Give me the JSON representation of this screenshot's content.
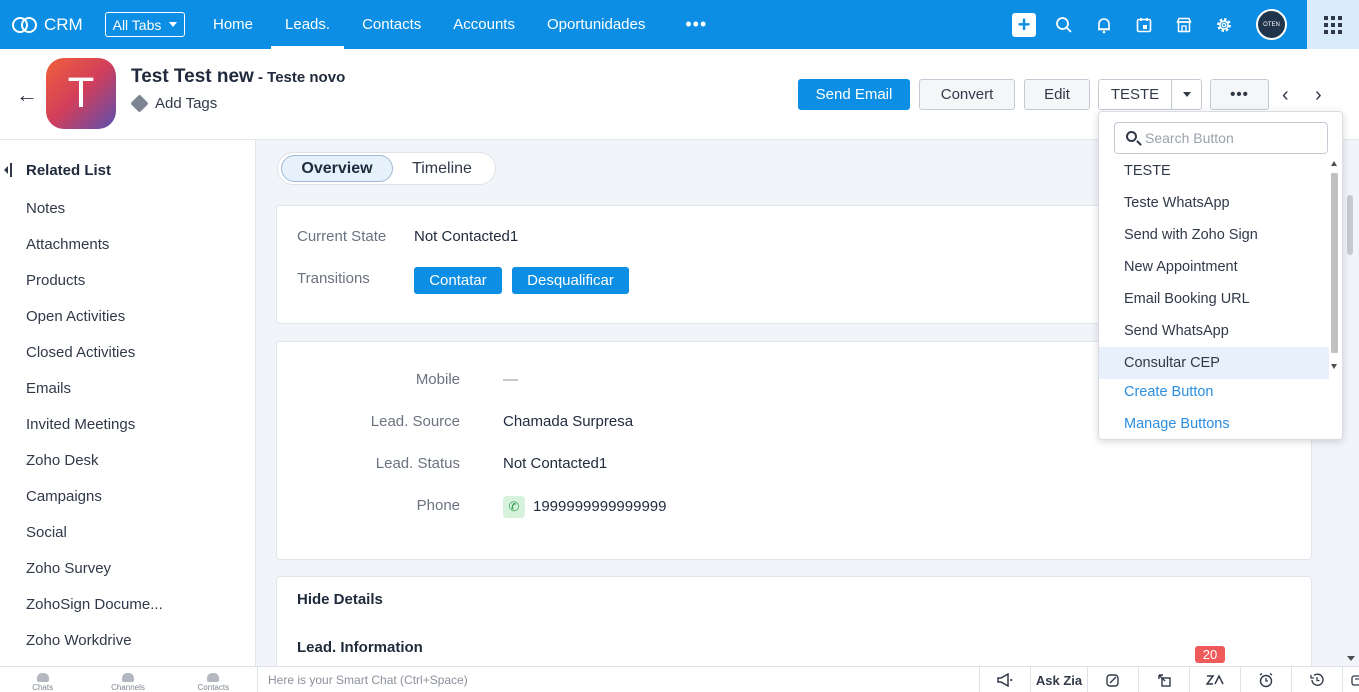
{
  "topnav": {
    "brand": "CRM",
    "all_tabs": "All Tabs",
    "tabs": [
      {
        "label": "Home"
      },
      {
        "label": "Leads."
      },
      {
        "label": "Contacts"
      },
      {
        "label": "Accounts"
      },
      {
        "label": "Oportunidades"
      }
    ],
    "more": "•••",
    "avatar_text": "OTEN",
    "icons": [
      "plus-icon",
      "search-icon",
      "bell-icon",
      "calendar-icon",
      "store-icon",
      "gear-icon",
      "apps-grid-icon"
    ],
    "accent": "#0b8ee3"
  },
  "record": {
    "avatar_letter": "T",
    "title": "Test Test new",
    "subtitle": " - Teste novo",
    "add_tags": "Add Tags",
    "buttons": {
      "send_email": "Send Email",
      "convert": "Convert",
      "edit": "Edit",
      "teste": "TESTE",
      "more": "•••"
    }
  },
  "sidebar": {
    "title": "Related List",
    "items": [
      "Notes",
      "Attachments",
      "Products",
      "Open Activities",
      "Closed Activities",
      "Emails",
      "Invited Meetings",
      "Zoho Desk",
      "Campaigns",
      "Social",
      "Zoho Survey",
      "ZohoSign Docume...",
      "Zoho Workdrive"
    ]
  },
  "main": {
    "tabs": {
      "overview": "Overview",
      "timeline": "Timeline"
    },
    "state": {
      "current_label": "Current State",
      "current_value": "Not Contacted1",
      "transitions_label": "Transitions",
      "transition_buttons": [
        "Contatar",
        "Desqualificar"
      ]
    },
    "fields": [
      {
        "label": "Mobile",
        "value": "—"
      },
      {
        "label": "Lead. Source",
        "value": "Chamada Surpresa"
      },
      {
        "label": "Lead. Status",
        "value": "Not Contacted1"
      },
      {
        "label": "Phone",
        "value": "1999999999999999"
      }
    ],
    "hide_details": "Hide Details",
    "section_title": "Lead. Information"
  },
  "dropdown": {
    "search_placeholder": "Search Button",
    "items": [
      "TESTE",
      "Teste WhatsApp",
      "Send with Zoho Sign",
      "New Appointment",
      "Email Booking URL",
      "Send WhatsApp",
      "Consultar CEP"
    ],
    "highlighted": "Consultar CEP",
    "create": "Create Button",
    "manage": "Manage Buttons"
  },
  "bottombar": {
    "tabs": [
      "Chats",
      "Channels",
      "Contacts"
    ],
    "smart_chat": "Here is your Smart Chat (Ctrl+Space)",
    "ask_zia": "Ask Zia",
    "badge": "20"
  }
}
